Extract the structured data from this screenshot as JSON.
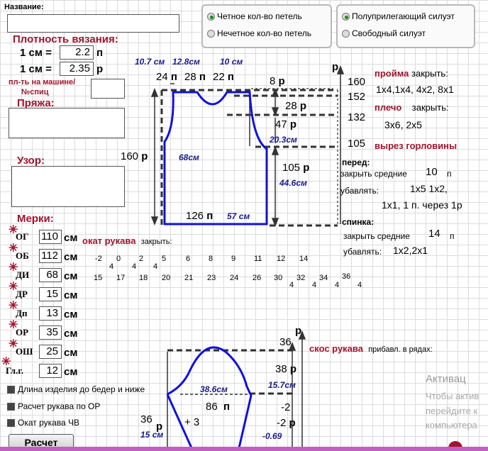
{
  "name_label": "Название:",
  "density": {
    "title": "Плотность вязания:",
    "row1_label": "1 см =",
    "row1_value": "2.2",
    "row1_unit": "п",
    "row2_label": "1 см =",
    "row2_value": "2.35",
    "row2_unit": "р"
  },
  "machine_label_1": "пл-ть на машине/",
  "machine_label_2": "№спиц",
  "yarn_label": "Пряжа:",
  "pattern_label": "Узор:",
  "stitch_radio": {
    "opt1": "Четное кол-во петель",
    "opt2": "Нечетное кол-во петель",
    "selected": 0
  },
  "fit_radio": {
    "opt1": "Полуприлегающий силуэт",
    "opt2": "Свободный силуэт",
    "selected": 0
  },
  "measure_title": "Мерки:",
  "measures": [
    {
      "label": "ОГ",
      "value": "110",
      "unit": "см"
    },
    {
      "label": "ОБ",
      "value": "112",
      "unit": "см"
    },
    {
      "label": "ДИ",
      "value": "68",
      "unit": "см"
    },
    {
      "label": "ДР",
      "value": "15",
      "unit": "см"
    },
    {
      "label": "Дп",
      "value": "13",
      "unit": "см"
    },
    {
      "label": "ОР",
      "value": "35",
      "unit": "см"
    },
    {
      "label": "ОШ",
      "value": "25",
      "unit": "см"
    },
    {
      "label": "Гл.г.",
      "value": "12",
      "unit": "см"
    }
  ],
  "checkboxes": [
    "Длина изделия до бедер и ниже",
    "Расчет рукава по ОР",
    "Окат рукава ЧВ"
  ],
  "calc_button": "Расчет",
  "body": {
    "top_cm": [
      "10.7",
      "12.8",
      "10"
    ],
    "cm": "см",
    "top_p": [
      "24",
      "28",
      "22"
    ],
    "p": "п",
    "r": "р",
    "r8": "8",
    "r28": "28",
    "r47": "47",
    "cm20": "20.3",
    "r105": "105",
    "cm44": "44.6",
    "r160": "160",
    "cm68": "68",
    "bottom_p": "126",
    "bottom_cm": "57",
    "right_nums": [
      "160",
      "152",
      "132",
      "105"
    ]
  },
  "instructions": {
    "armhole": "пройма",
    "close": "закрыть:",
    "armhole_vals": "1х4,1х4, 4х2, 8х1",
    "shoulder": "плечо",
    "shoulder_close": "закрыть:",
    "shoulder_vals": "3х6, 2х5",
    "neck": "вырез горловины",
    "front": "перед:",
    "front_close": "закрыть средние",
    "front_val": "10",
    "front_unit": "п",
    "front_dec": "убавлять:",
    "front_dec1": "1х5 1х2,",
    "front_dec2": "1х1, 1 п. через 1р",
    "back": "спинка:",
    "back_close": "закрыть средние",
    "back_val": "14",
    "back_unit": "п",
    "back_dec": "убавлять:",
    "back_dec1": "1х2,2х1"
  },
  "cap": {
    "title": "окат рукава",
    "close": "закрыть:",
    "row1": [
      "-2",
      "0",
      "2",
      "5",
      "6",
      "8",
      "9",
      "11",
      "12",
      "14"
    ],
    "row1_sub": [
      "4",
      "4",
      "4"
    ],
    "row2": [
      "15",
      "17",
      "18",
      "20",
      "21",
      "23",
      "24",
      "26",
      "30",
      "32",
      "34",
      "36"
    ],
    "row2_sub": [
      "4",
      "4",
      "4",
      "4"
    ]
  },
  "sleeve": {
    "title": "скос рукава",
    "inc": "прибавл. в рядах:",
    "r36top": "36",
    "r38": "38",
    "cm15_7": "15.7",
    "cm38_6": "38.6",
    "p86": "86",
    "minus2a": "-2",
    "minus2b": "-2",
    "left36": "36",
    "left15": "15",
    "plus3": "+ 3",
    "cm0_69": "-0.69"
  },
  "watermark": {
    "line1": "Активац",
    "line2": "Чтобы актив",
    "line3": "перейдите к",
    "line4": "компьютера"
  },
  "colors": {
    "accent": "#a0142d",
    "shape": "#1010e0",
    "ink": "#1a1a8c"
  }
}
